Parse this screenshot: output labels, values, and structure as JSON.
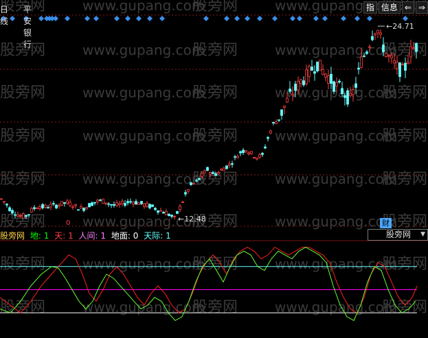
{
  "header": {
    "period": "日线",
    "stock_name": "平安银行",
    "buttons": [
      "指",
      "信息",
      "⇐",
      "⇒"
    ]
  },
  "price_annotations": {
    "high": "24.71",
    "low": "12.48"
  },
  "watermark": {
    "cn": "股旁网",
    "url": "www.gupang.com"
  },
  "indicator": {
    "name": "股旁网",
    "params": [
      {
        "label": "地:",
        "value": "1",
        "color": "#00ff00"
      },
      {
        "label": "天:",
        "value": "1",
        "color": "#ff4040"
      },
      {
        "label": "人间:",
        "value": "1",
        "color": "#ff80ff"
      },
      {
        "label": "地面:",
        "value": "0",
        "color": "#ffffff"
      },
      {
        "label": "天际:",
        "value": "1",
        "color": "#66ffff"
      }
    ],
    "selector_value": "股旁网",
    "badge": "财",
    "marker_zero": "0"
  },
  "colors": {
    "up": "#ff4040",
    "down": "#66ffff",
    "diamond": "#3b8eea",
    "grid": "#8b1a1a",
    "sky_line": "#66ffff",
    "human_line": "#ff00ff",
    "ground_line": "#ffffff",
    "osc_red": "#ff2020",
    "osc_green": "#66ff33"
  },
  "chart_data": [
    {
      "type": "candlestick",
      "title": "",
      "ylim": [
        12.0,
        25.5
      ],
      "annotated_high": 24.71,
      "annotated_low": 12.48,
      "close_path": [
        [
          0,
          13.8
        ],
        [
          8,
          13.5
        ],
        [
          16,
          13.0
        ],
        [
          24,
          12.8
        ],
        [
          32,
          12.6
        ],
        [
          40,
          12.7
        ],
        [
          48,
          13.1
        ],
        [
          56,
          13.3
        ],
        [
          64,
          13.2
        ],
        [
          72,
          13.3
        ],
        [
          80,
          13.3
        ],
        [
          88,
          13.4
        ],
        [
          96,
          13.5
        ],
        [
          104,
          13.4
        ],
        [
          112,
          13.2
        ],
        [
          120,
          13.1
        ],
        [
          128,
          13.3
        ],
        [
          136,
          13.5
        ],
        [
          144,
          13.6
        ],
        [
          152,
          13.6
        ],
        [
          160,
          13.4
        ],
        [
          168,
          13.3
        ],
        [
          176,
          13.4
        ],
        [
          184,
          13.5
        ],
        [
          192,
          13.6
        ],
        [
          200,
          13.5
        ],
        [
          208,
          13.4
        ],
        [
          216,
          13.3
        ],
        [
          224,
          13.2
        ],
        [
          232,
          13.0
        ],
        [
          240,
          12.9
        ],
        [
          248,
          12.7
        ],
        [
          254,
          12.48
        ],
        [
          262,
          13.2
        ],
        [
          270,
          14.0
        ],
        [
          278,
          14.6
        ],
        [
          286,
          14.8
        ],
        [
          294,
          15.2
        ],
        [
          302,
          15.6
        ],
        [
          310,
          15.3
        ],
        [
          318,
          15.4
        ],
        [
          326,
          15.7
        ],
        [
          334,
          15.9
        ],
        [
          342,
          16.3
        ],
        [
          350,
          16.7
        ],
        [
          358,
          16.9
        ],
        [
          366,
          16.6
        ],
        [
          374,
          16.4
        ],
        [
          382,
          16.5
        ],
        [
          390,
          17.6
        ],
        [
          398,
          18.5
        ],
        [
          406,
          18.8
        ],
        [
          414,
          19.6
        ],
        [
          422,
          20.3
        ],
        [
          430,
          20.7
        ],
        [
          438,
          21.2
        ],
        [
          446,
          21.5
        ],
        [
          454,
          22.0
        ],
        [
          462,
          22.3
        ],
        [
          470,
          21.9
        ],
        [
          478,
          21.5
        ],
        [
          486,
          21.0
        ],
        [
          494,
          20.8
        ],
        [
          502,
          20.4
        ],
        [
          510,
          20.0
        ],
        [
          518,
          21.0
        ],
        [
          526,
          22.5
        ],
        [
          534,
          23.2
        ],
        [
          542,
          24.2
        ],
        [
          548,
          24.71
        ],
        [
          556,
          23.6
        ],
        [
          564,
          22.8
        ],
        [
          572,
          22.4
        ],
        [
          580,
          22.0
        ],
        [
          588,
          21.8
        ],
        [
          596,
          23.0
        ],
        [
          604,
          23.4
        ]
      ]
    },
    {
      "type": "line",
      "title": "",
      "ylim": [
        -10,
        110
      ],
      "reference_lines": [
        {
          "name": "天际",
          "value": 80
        },
        {
          "name": "人间",
          "value": 50
        },
        {
          "name": "地面",
          "value": 20
        }
      ],
      "series": [
        {
          "name": "天",
          "points": [
            [
              0,
              40
            ],
            [
              15,
              30
            ],
            [
              30,
              20
            ],
            [
              45,
              35
            ],
            [
              60,
              55
            ],
            [
              75,
              70
            ],
            [
              90,
              85
            ],
            [
              100,
              95
            ],
            [
              110,
              90
            ],
            [
              120,
              70
            ],
            [
              130,
              45
            ],
            [
              140,
              35
            ],
            [
              150,
              50
            ],
            [
              160,
              70
            ],
            [
              170,
              80
            ],
            [
              180,
              70
            ],
            [
              190,
              55
            ],
            [
              200,
              40
            ],
            [
              210,
              30
            ],
            [
              220,
              45
            ],
            [
              230,
              55
            ],
            [
              240,
              45
            ],
            [
              250,
              30
            ],
            [
              260,
              20
            ],
            [
              270,
              25
            ],
            [
              280,
              45
            ],
            [
              290,
              70
            ],
            [
              300,
              85
            ],
            [
              310,
              95
            ],
            [
              320,
              85
            ],
            [
              330,
              70
            ],
            [
              340,
              90
            ],
            [
              350,
              100
            ],
            [
              360,
              105
            ],
            [
              370,
              100
            ],
            [
              380,
              90
            ],
            [
              390,
              95
            ],
            [
              400,
              105
            ],
            [
              410,
              100
            ],
            [
              420,
              95
            ],
            [
              430,
              100
            ],
            [
              440,
              105
            ],
            [
              450,
              105
            ],
            [
              460,
              100
            ],
            [
              470,
              95
            ],
            [
              480,
              85
            ],
            [
              490,
              60
            ],
            [
              500,
              40
            ],
            [
              510,
              25
            ],
            [
              520,
              20
            ],
            [
              530,
              40
            ],
            [
              540,
              70
            ],
            [
              550,
              85
            ],
            [
              560,
              80
            ],
            [
              570,
              60
            ],
            [
              580,
              40
            ],
            [
              590,
              30
            ],
            [
              600,
              40
            ],
            [
              607,
              55
            ]
          ]
        },
        {
          "name": "地",
          "points": [
            [
              0,
              25
            ],
            [
              15,
              20
            ],
            [
              30,
              35
            ],
            [
              45,
              55
            ],
            [
              60,
              70
            ],
            [
              75,
              80
            ],
            [
              85,
              78
            ],
            [
              95,
              65
            ],
            [
              105,
              50
            ],
            [
              115,
              35
            ],
            [
              125,
              25
            ],
            [
              135,
              35
            ],
            [
              145,
              55
            ],
            [
              155,
              70
            ],
            [
              165,
              65
            ],
            [
              175,
              55
            ],
            [
              185,
              45
            ],
            [
              195,
              35
            ],
            [
              205,
              25
            ],
            [
              215,
              30
            ],
            [
              225,
              40
            ],
            [
              235,
              35
            ],
            [
              245,
              20
            ],
            [
              255,
              10
            ],
            [
              265,
              15
            ],
            [
              275,
              35
            ],
            [
              285,
              60
            ],
            [
              295,
              80
            ],
            [
              305,
              90
            ],
            [
              315,
              75
            ],
            [
              325,
              60
            ],
            [
              335,
              80
            ],
            [
              345,
              95
            ],
            [
              355,
              100
            ],
            [
              365,
              95
            ],
            [
              375,
              80
            ],
            [
              385,
              75
            ],
            [
              395,
              90
            ],
            [
              405,
              100
            ],
            [
              415,
              95
            ],
            [
              425,
              90
            ],
            [
              435,
              100
            ],
            [
              445,
              105
            ],
            [
              455,
              100
            ],
            [
              465,
              95
            ],
            [
              475,
              85
            ],
            [
              485,
              55
            ],
            [
              495,
              30
            ],
            [
              505,
              15
            ],
            [
              515,
              10
            ],
            [
              525,
              30
            ],
            [
              535,
              60
            ],
            [
              545,
              80
            ],
            [
              555,
              75
            ],
            [
              565,
              50
            ],
            [
              575,
              30
            ],
            [
              585,
              20
            ],
            [
              595,
              25
            ],
            [
              605,
              35
            ]
          ]
        }
      ]
    }
  ]
}
